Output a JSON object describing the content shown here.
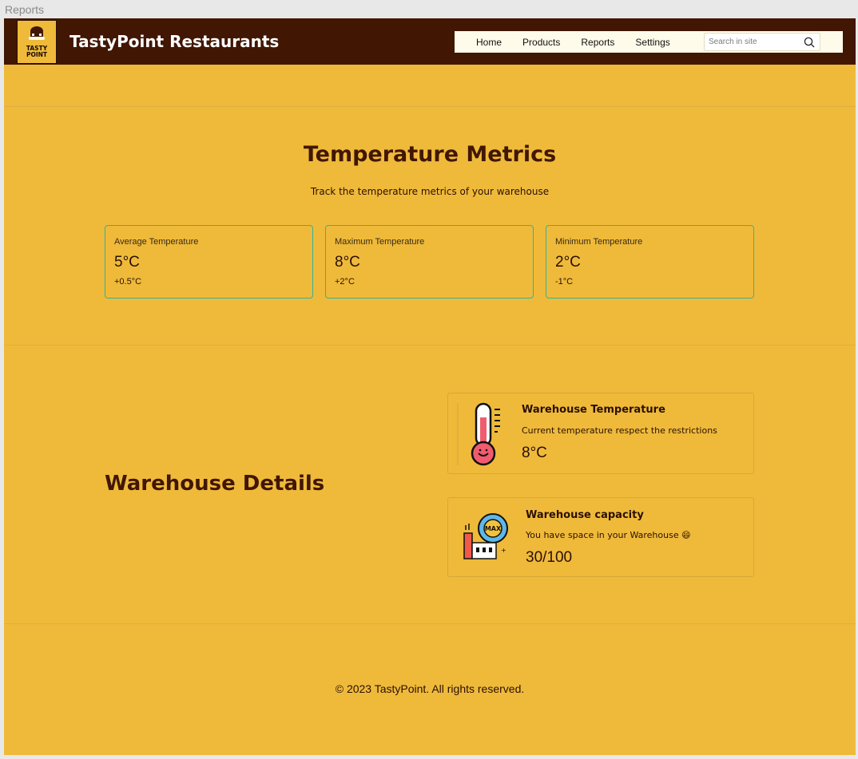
{
  "frame": {
    "label": "Reports"
  },
  "header": {
    "brand": "TastyPoint Restaurants",
    "logo_text_1": "TASTY",
    "logo_text_2": "POINT",
    "nav": [
      {
        "label": "Home"
      },
      {
        "label": "Products"
      },
      {
        "label": "Reports"
      },
      {
        "label": "Settings"
      }
    ],
    "search": {
      "placeholder": "Search in site",
      "icon": "search-icon"
    }
  },
  "metrics": {
    "title": "Temperature Metrics",
    "subtitle": "Track the temperature metrics of your warehouse",
    "cards": [
      {
        "label": "Average Temperature",
        "value": "5°C",
        "change": "+0.5°C"
      },
      {
        "label": "Maximum Temperature",
        "value": "8°C",
        "change": "+2°C"
      },
      {
        "label": "Minimum Temperature",
        "value": "2°C",
        "change": "-1°C"
      }
    ]
  },
  "warehouse": {
    "title": "Warehouse Details",
    "temperature_card": {
      "title": "Warehouse Temperature",
      "description": "Current temperature respect the restrictions",
      "value": "8°C",
      "icon": "thermometer-icon"
    },
    "capacity_card": {
      "title": "Warehouse capacity",
      "description": "You have space in your Warehouse 😄",
      "value": "30/100",
      "icon": "warehouse-capacity-icon",
      "icon_text": "MAX"
    }
  },
  "footer": {
    "text": "© 2023 TastyPoint. All rights reserved."
  },
  "colors": {
    "background": "#efba3a",
    "header": "#411603",
    "accent_border": "#33b39a"
  }
}
